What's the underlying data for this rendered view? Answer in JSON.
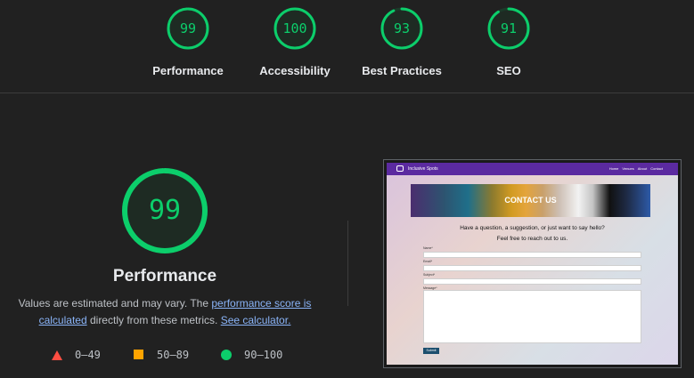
{
  "colors": {
    "pass": "#0cce6b",
    "average": "#ffa400",
    "fail": "#ff4e42",
    "link": "#8ab4f8"
  },
  "categories": [
    {
      "score": "99",
      "label": "Performance",
      "value": 0.99
    },
    {
      "score": "100",
      "label": "Accessibility",
      "value": 1.0
    },
    {
      "score": "93",
      "label": "Best Practices",
      "value": 0.93
    },
    {
      "score": "91",
      "label": "SEO",
      "value": 0.91
    }
  ],
  "performance": {
    "score": "99",
    "value": 0.99,
    "title": "Performance",
    "desc_prefix": "Values are estimated and may vary. The ",
    "desc_link1": "performance score is calculated",
    "desc_middle": " directly from these metrics. ",
    "desc_link2": "See calculator."
  },
  "legend": {
    "fail": "0–49",
    "average": "50–89",
    "pass": "90–100"
  },
  "screenshot": {
    "brand": "Inclusive Spots",
    "nav": [
      "Home",
      "Venues",
      "About",
      "Contact"
    ],
    "hero_title": "CONTACT US",
    "intro_line1": "Have a question, a suggestion, or just want to say hello?",
    "intro_line2": "Feel free to reach out to us.",
    "field_name": "Name*",
    "field_email": "Email*",
    "field_subject": "Subject*",
    "field_message": "Message*",
    "submit": "Submit"
  }
}
